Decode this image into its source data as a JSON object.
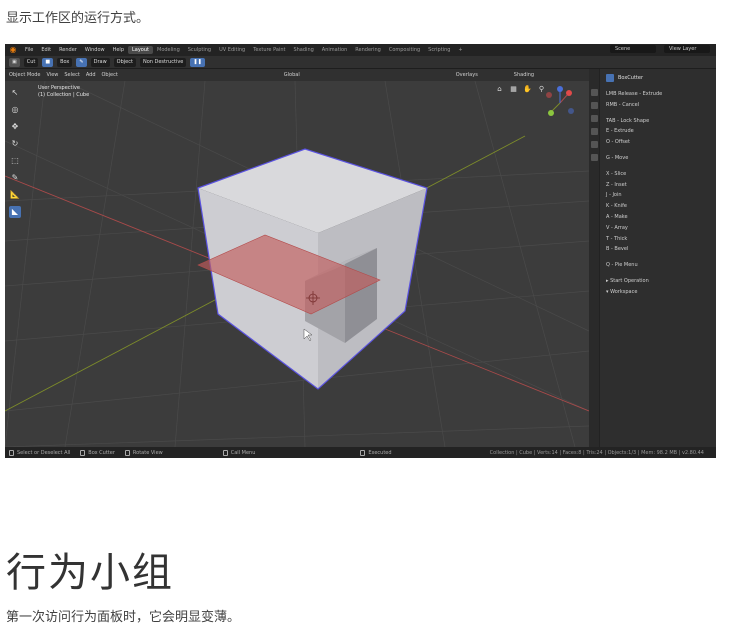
{
  "intro_text": "显示工作区的运行方式。",
  "heading": "行为小组",
  "subtext": "第一次访问行为面板时，它会明显变薄。",
  "blender": {
    "menu": [
      "File",
      "Edit",
      "Render",
      "Window",
      "Help"
    ],
    "workspaces": [
      "Layout",
      "Modeling",
      "Sculpting",
      "UV Editing",
      "Texture Paint",
      "Shading",
      "Animation",
      "Rendering",
      "Compositing",
      "Scripting",
      "+"
    ],
    "active_workspace": "Layout",
    "scene": "Scene",
    "view_layer": "View Layer",
    "toolbar": {
      "cut": "Cut",
      "box": "Box",
      "draw": "Draw",
      "object": "Object",
      "non_destructive": "Non Destructive"
    },
    "header": {
      "mode": "Object Mode",
      "view": "View",
      "select": "Select",
      "add": "Add",
      "object": "Object",
      "orientation": "Global",
      "overlays": "Overlays",
      "shading": "Shading"
    },
    "viewport": {
      "perspective": "User Perspective",
      "collection": "(1) Collection | Cube"
    },
    "npanel": {
      "title": "BoxCutter",
      "lines": [
        "LMB Release - Extrude",
        "RMB - Cancel",
        "",
        "TAB - Lock Shape",
        "E - Extrude",
        "O - Offset",
        "",
        "G - Move",
        "",
        "X - Slice",
        "Z - Inset",
        "J - Join",
        "K - Knife",
        "A - Make",
        "V - Array",
        "T - Thick",
        "B - Bevel",
        "",
        "Q - Pie Menu",
        "",
        "▸ Start Operation",
        "▾ Workspace"
      ]
    },
    "status": {
      "select": "Select or Deselect All",
      "boxcutter": "Box Cutter",
      "rotate": "Rotate View",
      "call_menu": "Call Menu",
      "executed": "Executed",
      "stats": "Collection | Cube | Verts:14 | Faces:8 | Tris:24 | Objects:1/3 | Mem: 98.2 MB | v2.80.44"
    },
    "colors": {
      "accent": "#4772b3",
      "cube_face": "#c8c8cc",
      "cut_plane": "#c25c5c",
      "select_outline": "#5a52e0",
      "grid_x_axis": "#a84a4a",
      "grid_y_axis": "#7d8c2a"
    }
  }
}
